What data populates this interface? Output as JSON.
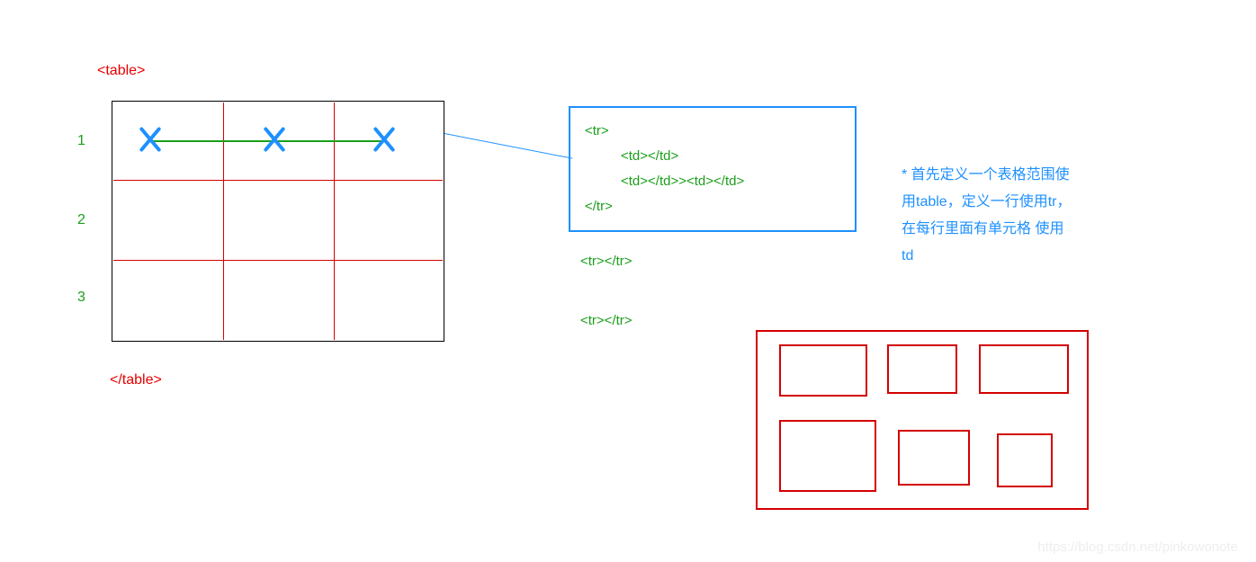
{
  "labels": {
    "table_open": "<table>",
    "table_close": "</table>",
    "row1": "1",
    "row2": "2",
    "row3": "3"
  },
  "code_box": {
    "line1": "<tr>",
    "line2": "<td></td>",
    "line3": "<td></td>><td></td>",
    "line4": "</tr>"
  },
  "tr_empty1": "<tr></tr>",
  "tr_empty2": "<tr></tr>",
  "explanation": "* 首先定义一个表格范围使用table，定义一行使用tr，在每行里面有单元格 使用td",
  "watermark": "https://blog.csdn.net/pinkowonote",
  "chart_data": {
    "type": "diagram",
    "description": "HTML table structure explanation",
    "elements": {
      "table_tag": "<table></table>",
      "row_tag": "<tr></tr>",
      "cell_tag": "<td></td>",
      "grid": {
        "rows": 3,
        "cols": 3
      },
      "callout_row": 1,
      "red_cells_layout": {
        "rows": 2,
        "cols": 3
      }
    }
  }
}
